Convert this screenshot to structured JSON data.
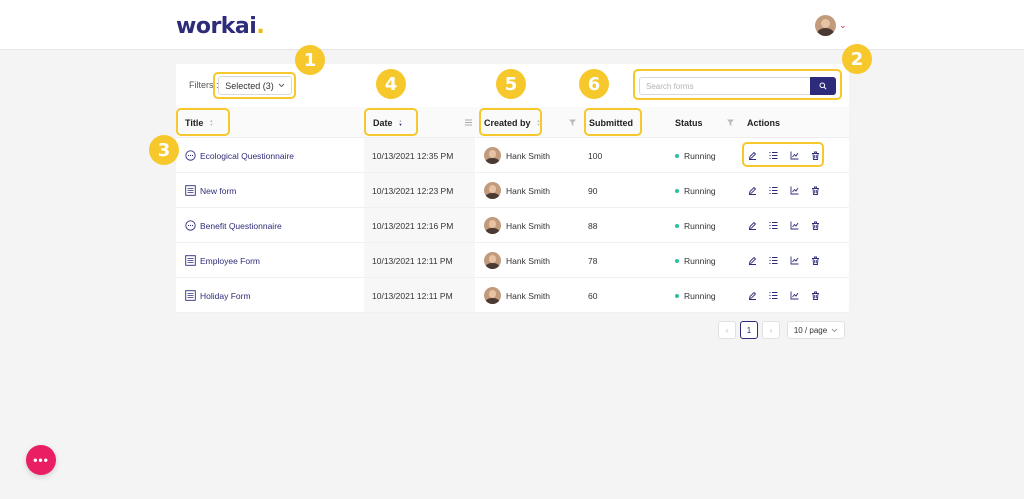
{
  "app": {
    "logo_text": "workai",
    "logo_dot": "."
  },
  "user": {
    "menu_chevron": "⌄"
  },
  "toolbar": {
    "filters_label": "Filters :",
    "filter_value": "Selected (3)",
    "search_placeholder": "Search forms"
  },
  "table": {
    "columns": {
      "title": "Title",
      "date": "Date",
      "created_by": "Created by",
      "submitted": "Submitted",
      "status": "Status",
      "actions": "Actions"
    },
    "sort": {
      "date": "descending"
    },
    "rows": [
      {
        "icon": "chat-bubble-icon",
        "title": "Ecological Questionnaire",
        "date": "10/13/2021 12:35 PM",
        "author": "Hank Smith",
        "submitted": "100",
        "status": "Running"
      },
      {
        "icon": "form-list-icon",
        "title": "New form",
        "date": "10/13/2021 12:23 PM",
        "author": "Hank Smith",
        "submitted": "90",
        "status": "Running"
      },
      {
        "icon": "chat-bubble-icon",
        "title": "Benefit Questionnaire",
        "date": "10/13/2021 12:16 PM",
        "author": "Hank Smith",
        "submitted": "88",
        "status": "Running"
      },
      {
        "icon": "form-list-icon",
        "title": "Employee Form",
        "date": "10/13/2021 12:11 PM",
        "author": "Hank Smith",
        "submitted": "78",
        "status": "Running"
      },
      {
        "icon": "form-list-icon",
        "title": "Holiday Form",
        "date": "10/13/2021 12:11 PM",
        "author": "Hank Smith",
        "submitted": "60",
        "status": "Running"
      }
    ]
  },
  "pagination": {
    "prev": "‹",
    "current": "1",
    "next": "›",
    "page_size": "10 / page"
  },
  "fab": {
    "label": "•••"
  },
  "callouts": [
    "1",
    "2",
    "3",
    "4",
    "5",
    "6"
  ],
  "colors": {
    "brand": "#2e2c7a",
    "accent": "#f5b800",
    "callout": "#f6c82c",
    "status_running": "#25c3a1",
    "fab": "#e91e63"
  }
}
